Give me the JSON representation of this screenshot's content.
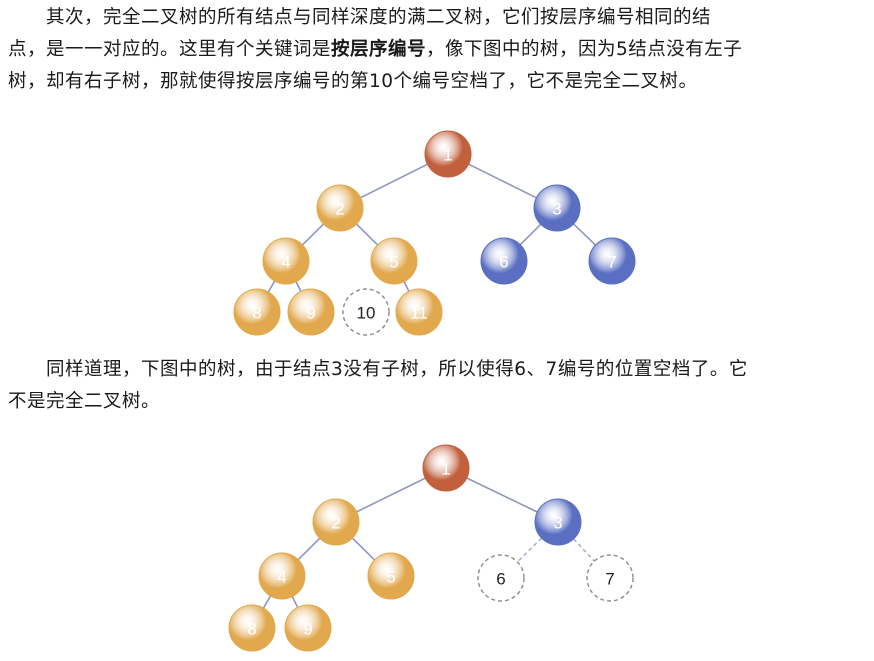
{
  "paragraph1": {
    "lines": [
      "其次，完全二叉树的所有结点与同样深度的满二叉树，它们按层序编号相同的结",
      "点，是一一对应的。这里有个关键词是",
      "，像下图中的树，因为5结点没有左子",
      "树，却有右子树，那就使得按层序编号的第10个编号空档了，它不是完全二叉树。"
    ],
    "keyword": "按层序编号"
  },
  "paragraph2": {
    "lines": [
      "同样道理，下图中的树，由于结点3没有子树，所以使得6、7编号的位置空档了。它",
      "不是完全二叉树。"
    ]
  },
  "colors": {
    "root": "#c2603e",
    "left_subtree": "#e1a84d",
    "right_subtree": "#5a6fc2",
    "missing": "#ffffff",
    "edge": "#8d96bf"
  },
  "tree1": {
    "nodes": [
      {
        "id": "1",
        "group": "root"
      },
      {
        "id": "2",
        "group": "left"
      },
      {
        "id": "3",
        "group": "right"
      },
      {
        "id": "4",
        "group": "left"
      },
      {
        "id": "5",
        "group": "left"
      },
      {
        "id": "6",
        "group": "right"
      },
      {
        "id": "7",
        "group": "right"
      },
      {
        "id": "8",
        "group": "left"
      },
      {
        "id": "9",
        "group": "left"
      },
      {
        "id": "10",
        "group": "missing"
      },
      {
        "id": "11",
        "group": "left"
      }
    ],
    "edges": [
      [
        "1",
        "2"
      ],
      [
        "1",
        "3"
      ],
      [
        "2",
        "4"
      ],
      [
        "2",
        "5"
      ],
      [
        "3",
        "6"
      ],
      [
        "3",
        "7"
      ],
      [
        "4",
        "8"
      ],
      [
        "4",
        "9"
      ],
      [
        "5",
        "11"
      ]
    ],
    "dashed_edges": []
  },
  "tree2": {
    "nodes": [
      {
        "id": "1",
        "group": "root"
      },
      {
        "id": "2",
        "group": "left"
      },
      {
        "id": "3",
        "group": "right"
      },
      {
        "id": "4",
        "group": "left"
      },
      {
        "id": "5",
        "group": "left"
      },
      {
        "id": "6",
        "group": "missing"
      },
      {
        "id": "7",
        "group": "missing"
      },
      {
        "id": "8",
        "group": "left"
      },
      {
        "id": "9",
        "group": "left"
      }
    ],
    "edges": [
      [
        "1",
        "2"
      ],
      [
        "1",
        "3"
      ],
      [
        "2",
        "4"
      ],
      [
        "2",
        "5"
      ],
      [
        "4",
        "8"
      ],
      [
        "4",
        "9"
      ]
    ],
    "dashed_edges": [
      [
        "3",
        "6"
      ],
      [
        "3",
        "7"
      ]
    ]
  }
}
